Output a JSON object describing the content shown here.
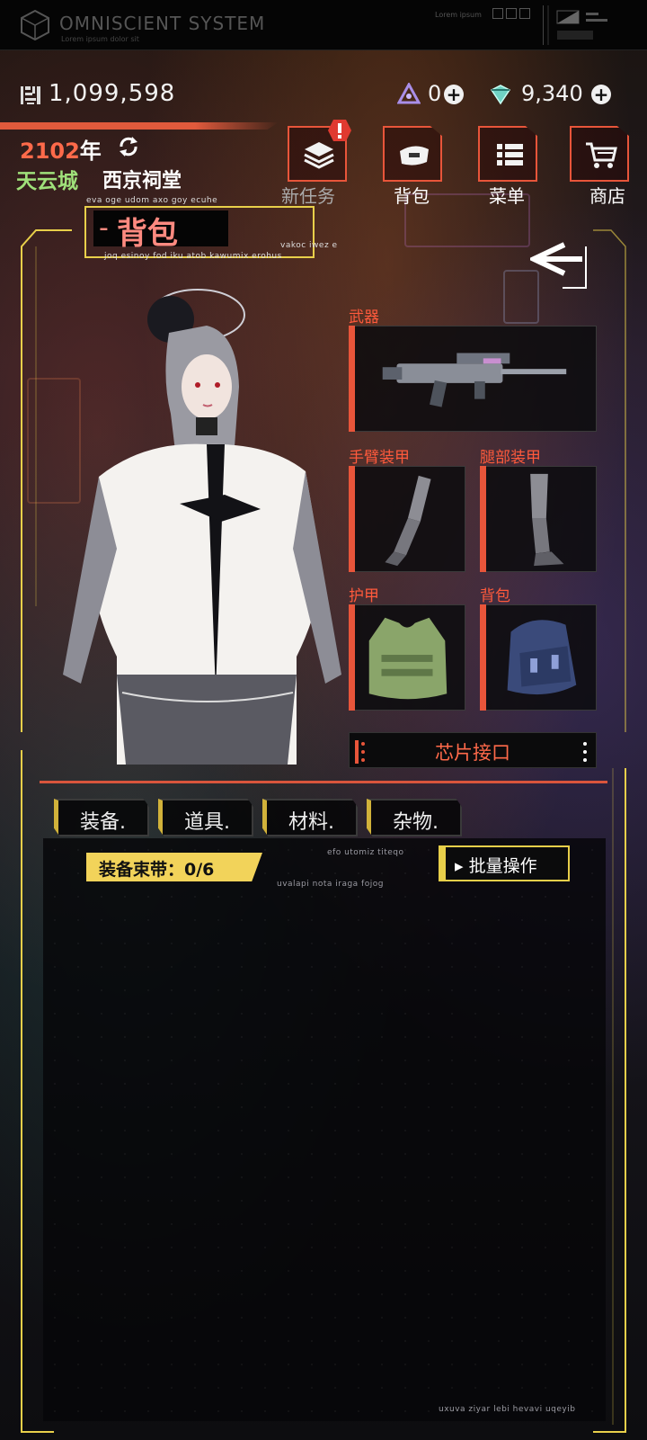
{
  "system": {
    "title": "OMNISCIENT SYSTEM",
    "subtitle": "Lorem ipsum dolor sit",
    "top_small": "Lorem ipsum"
  },
  "resources": {
    "gold": "1,099,598",
    "crystal": "0",
    "gem": "9,340"
  },
  "date": {
    "year": "2102",
    "year_suffix": "年"
  },
  "location": {
    "city": "天云城",
    "place": "西京祠堂"
  },
  "nav": [
    {
      "label": "新任务",
      "icon": "layers-icon",
      "alert": true
    },
    {
      "label": "背包",
      "icon": "bag-icon"
    },
    {
      "label": "菜单",
      "icon": "menu-icon"
    },
    {
      "label": "商店",
      "icon": "cart-icon"
    }
  ],
  "header": {
    "title": "背包",
    "top_caption": "eva oge udom axo goy ecuhe",
    "sub_caption": "joq esinoy fod iku atob kawumix erohus",
    "right_caption": "vakoc iwez e"
  },
  "equipment": {
    "weapon_label": "武器",
    "arm_label": "手臂装甲",
    "leg_label": "腿部装甲",
    "armor_label": "护甲",
    "backpack_label": "背包",
    "chip_label": "芯片接口"
  },
  "tabs": [
    {
      "label": "装备."
    },
    {
      "label": "道具."
    },
    {
      "label": "材料."
    },
    {
      "label": "杂物."
    }
  ],
  "inventory": {
    "belt_label": "装备束带：0/6",
    "batch_label": "批量操作",
    "caption_1": "efo utomiz titeqo",
    "caption_2": "uvalapi nota iraga fojog",
    "footer_caption": "uxuva ziyar lebi hevavi uqeyib"
  },
  "colors": {
    "accent_red": "#e8553a",
    "accent_yellow": "#e8cf4a",
    "city_green": "#9fe07a"
  }
}
